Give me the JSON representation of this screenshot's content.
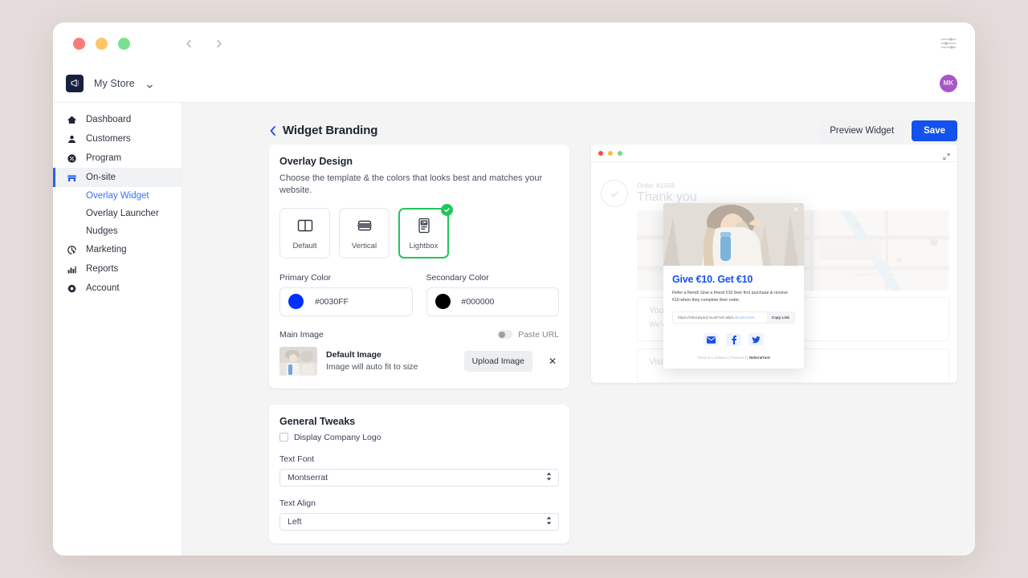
{
  "window": {
    "traffic_lights": [
      "red",
      "yellow",
      "green"
    ],
    "nav_back_icon": "chevron-left-icon",
    "nav_forward_icon": "chevron-right-icon",
    "settings_icon": "sliders-icon"
  },
  "appbar": {
    "logo_icon": "megaphone-icon",
    "store_name": "My Store",
    "store_chevron_icon": "chevron-down-icon",
    "avatar_initials": "MK"
  },
  "sidebar": {
    "items": [
      {
        "label": "Dashboard",
        "icon": "home-icon",
        "active": false
      },
      {
        "label": "Customers",
        "icon": "user-icon",
        "active": false
      },
      {
        "label": "Program",
        "icon": "percent-badge-icon",
        "active": false
      },
      {
        "label": "On-site",
        "icon": "storefront-icon",
        "active": true
      },
      {
        "label": "Marketing",
        "icon": "target-cursor-icon",
        "active": false
      },
      {
        "label": "Reports",
        "icon": "bar-chart-icon",
        "active": false
      },
      {
        "label": "Account",
        "icon": "gear-icon",
        "active": false
      }
    ],
    "sub_items": [
      {
        "label": "Overlay Widget",
        "current": true
      },
      {
        "label": "Overlay Launcher",
        "current": false
      },
      {
        "label": "Nudges",
        "current": false
      }
    ]
  },
  "header": {
    "back_icon": "chevron-left-icon",
    "title": "Widget Branding",
    "preview_button": "Preview Widget",
    "save_button": "Save",
    "save_color": "#1452ee"
  },
  "overlay_design": {
    "title": "Overlay Design",
    "subtitle": "Choose the template & the colors that looks best and matches your website.",
    "templates": [
      {
        "label": "Default",
        "icon": "split-columns-icon",
        "selected": false
      },
      {
        "label": "Vertical",
        "icon": "split-rows-icon",
        "selected": false
      },
      {
        "label": "Lightbox",
        "icon": "document-image-icon",
        "selected": true
      }
    ],
    "selected_check_icon": "check-circle-icon",
    "selected_color": "#22c55e",
    "primary_color": {
      "label": "Primary Color",
      "value": "#0030FF"
    },
    "secondary_color": {
      "label": "Secondary Color",
      "value": "#000000"
    },
    "main_image": {
      "label": "Main Image",
      "toggle_label": "Paste URL",
      "toggle_on": false,
      "title": "Default Image",
      "description": "Image will auto fit to size",
      "upload_button": "Upload Image",
      "remove_icon": "close-icon"
    }
  },
  "general_tweaks": {
    "title": "General Tweaks",
    "display_logo_label": "Display Company Logo",
    "display_logo_checked": false,
    "text_font_label": "Text Font",
    "text_font_value": "Montserrat",
    "text_align_label": "Text Align",
    "text_align_value": "Left"
  },
  "preview": {
    "traffic_lights": [
      "red",
      "yellow",
      "green"
    ],
    "expand_icon": "expand-icon",
    "background": {
      "check_icon": "check-icon",
      "order_label": "Order #1568",
      "thanks_label": "Thank you",
      "card_one_title": "Your order",
      "card_one_text": "We've acc                      back to this page for updates o",
      "card_two_title": "Visit us in-store"
    },
    "modal": {
      "close_icon": "close-icon",
      "headline": "Give €10. Get €10",
      "body": "Refer a friend! Give a friend €10 their first purchase & receive €10 when they complete their order.",
      "referral_url": "https://referralyard.local/?ref=&fpl=",
      "referral_url_tail": "abcde123nb",
      "copy_button": "Copy Link",
      "socials": [
        {
          "name": "email-icon"
        },
        {
          "name": "facebook-icon"
        },
        {
          "name": "twitter-icon"
        }
      ],
      "footer_terms": "Terms & Conditions",
      "footer_separator": "|",
      "footer_powered": "Powered by",
      "footer_brand": "ReferralYard"
    }
  }
}
